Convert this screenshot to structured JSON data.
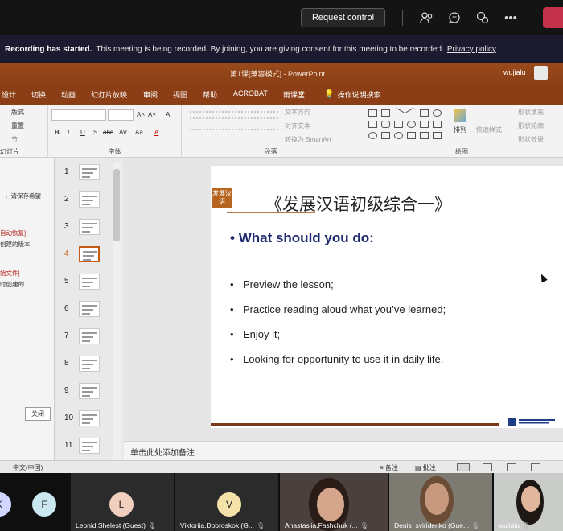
{
  "teams": {
    "request_control": "Request control",
    "icons": [
      "people-icon",
      "chat-icon",
      "reactions-icon",
      "more-icon"
    ],
    "more": "•••"
  },
  "banner": {
    "bold": "Recording has started.",
    "text": "This meeting is being recorded. By joining, you are giving consent for this meeting to be recorded.",
    "link": "Privacy policy"
  },
  "ppt": {
    "title": "第1课[兼容模式] - PowerPoint",
    "user": "wujialu",
    "tabs": [
      "设计",
      "切换",
      "动画",
      "幻灯片放映",
      "审阅",
      "视图",
      "帮助",
      "ACROBAT",
      "雨课堂"
    ],
    "help_search": "操作说明搜索",
    "ribbon": {
      "layout": "版式",
      "reset": "重置",
      "section": "节",
      "slides_group": "幻灯片",
      "font_group": "字体",
      "para_group": "段落",
      "drawing_group": "绘图",
      "text_direction": "文字方向",
      "align_text": "对齐文本",
      "smartart": "转换为 SmartArt",
      "arrange": "排列",
      "quick_styles": "快速样式",
      "shape_fill": "形状填充",
      "shape_outline": "形状轮廓",
      "shape_effects": "形状效果",
      "font_buttons": [
        "B",
        "I",
        "U",
        "S",
        "abc",
        "AV",
        "Aa",
        "A"
      ],
      "font_size_buttons": [
        "A˄",
        "A˅",
        "A"
      ]
    },
    "left_panel": {
      "lines": [
        "，请保存希望",
        "自动恢复]",
        "创建的版本",
        "始文件]",
        "时创建的..."
      ],
      "close": "关闭"
    },
    "thumbnails": [
      "1",
      "2",
      "3",
      "4",
      "5",
      "6",
      "7",
      "8",
      "9",
      "10",
      "11"
    ],
    "selected_thumbnail": "4",
    "slide": {
      "logo": "发展汉语",
      "title": "《发展汉语初级综合一》",
      "heading": "What should you do:",
      "bullets": [
        "Preview the lesson;",
        "Practice reading aloud what you’ve learned;",
        "Enjoy it;",
        "Looking for opportunity to use it in daily life."
      ]
    },
    "notes_placeholder": "单击此处添加备注",
    "status": {
      "language": "中文(中国)",
      "notes": "备注",
      "comments": "批注"
    }
  },
  "participants": [
    {
      "initial": "K",
      "name": ""
    },
    {
      "initial": "F",
      "name": ""
    },
    {
      "initial": "L",
      "name": "Leonid.Shelest (Guest)"
    },
    {
      "initial": "V",
      "name": "Viktoriia.Dobroskok (G..."
    },
    {
      "initial": "",
      "name": "Anastasiia.Fashchuk (..."
    },
    {
      "initial": "",
      "name": "Denis_sviridenko (Gue..."
    },
    {
      "initial": "",
      "name": "wujialu"
    }
  ]
}
